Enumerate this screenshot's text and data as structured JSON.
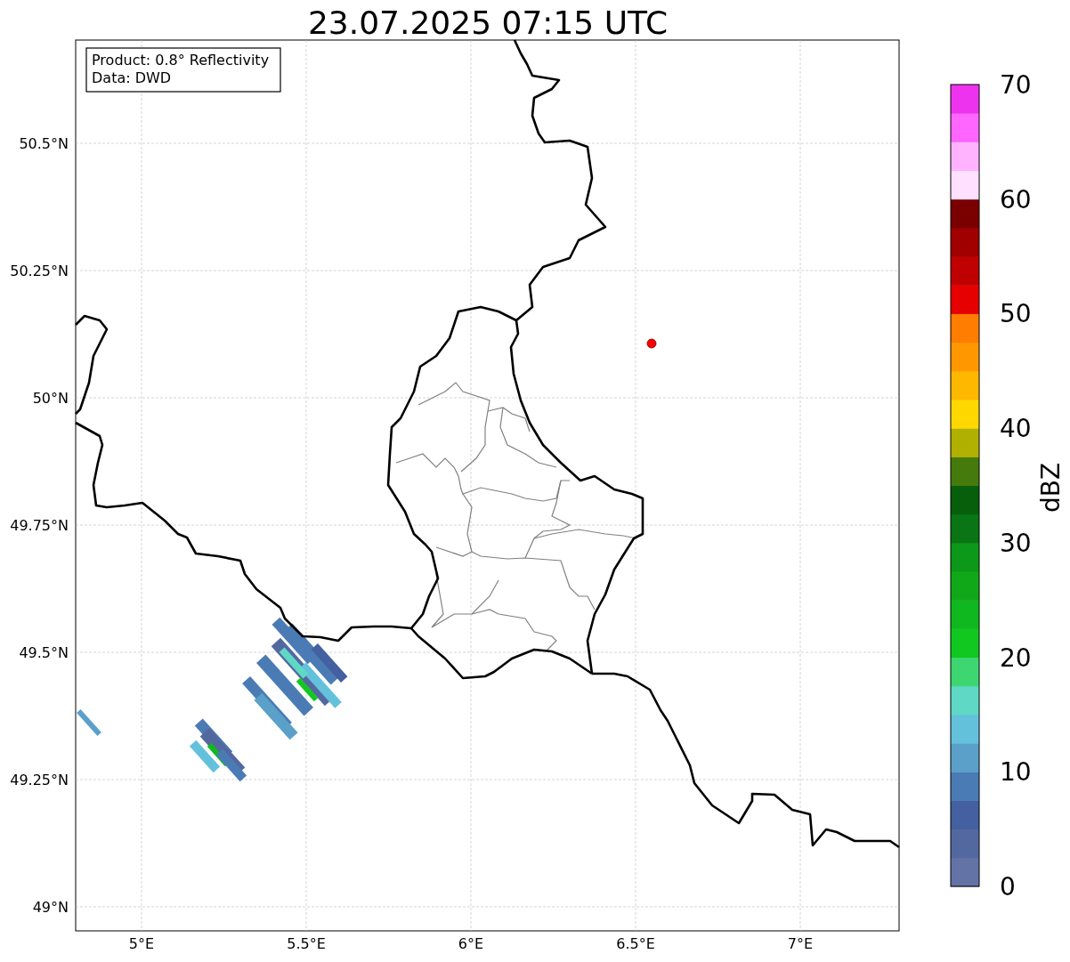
{
  "title": "23.07.2025 07:15 UTC",
  "info_box": {
    "lines": [
      "Product: 0.8° Reflectivity",
      "Data: DWD"
    ]
  },
  "map": {
    "x_ticks": [
      {
        "label": "5°E"
      },
      {
        "label": "5.5°E"
      },
      {
        "label": "6°E"
      },
      {
        "label": "6.5°E"
      },
      {
        "label": "7°E"
      }
    ],
    "y_ticks": [
      {
        "label": "50.5°N"
      },
      {
        "label": "50.25°N"
      },
      {
        "label": "50°N"
      },
      {
        "label": "49.75°N"
      },
      {
        "label": "49.5°N"
      },
      {
        "label": "49.25°N"
      },
      {
        "label": "49°N"
      }
    ]
  },
  "colorbar": {
    "label": "dBZ",
    "ticks": [
      {
        "label": "70"
      },
      {
        "label": "60"
      },
      {
        "label": "50"
      },
      {
        "label": "40"
      },
      {
        "label": "30"
      },
      {
        "label": "20"
      },
      {
        "label": "10"
      },
      {
        "label": "0"
      }
    ],
    "bins": [
      {
        "color": "#6473a6"
      },
      {
        "color": "#5468a0"
      },
      {
        "color": "#4460a0"
      },
      {
        "color": "#4b7bb5"
      },
      {
        "color": "#5aa0c8"
      },
      {
        "color": "#63c1dc"
      },
      {
        "color": "#5fd8c5"
      },
      {
        "color": "#3dd671"
      },
      {
        "color": "#10c81f"
      },
      {
        "color": "#10b81f"
      },
      {
        "color": "#10a818"
      },
      {
        "color": "#0c9818"
      },
      {
        "color": "#0a7514"
      },
      {
        "color": "#075f0c"
      },
      {
        "color": "#457a0c"
      },
      {
        "color": "#b0b000"
      },
      {
        "color": "#ffd800"
      },
      {
        "color": "#ffb800"
      },
      {
        "color": "#ff9800"
      },
      {
        "color": "#ff7d00"
      },
      {
        "color": "#e60000"
      },
      {
        "color": "#c00000"
      },
      {
        "color": "#a00000"
      },
      {
        "color": "#7a0000"
      },
      {
        "color": "#ffe0ff"
      },
      {
        "color": "#ffb3ff"
      },
      {
        "color": "#ff66ff"
      },
      {
        "color": "#ee33ee"
      }
    ]
  }
}
